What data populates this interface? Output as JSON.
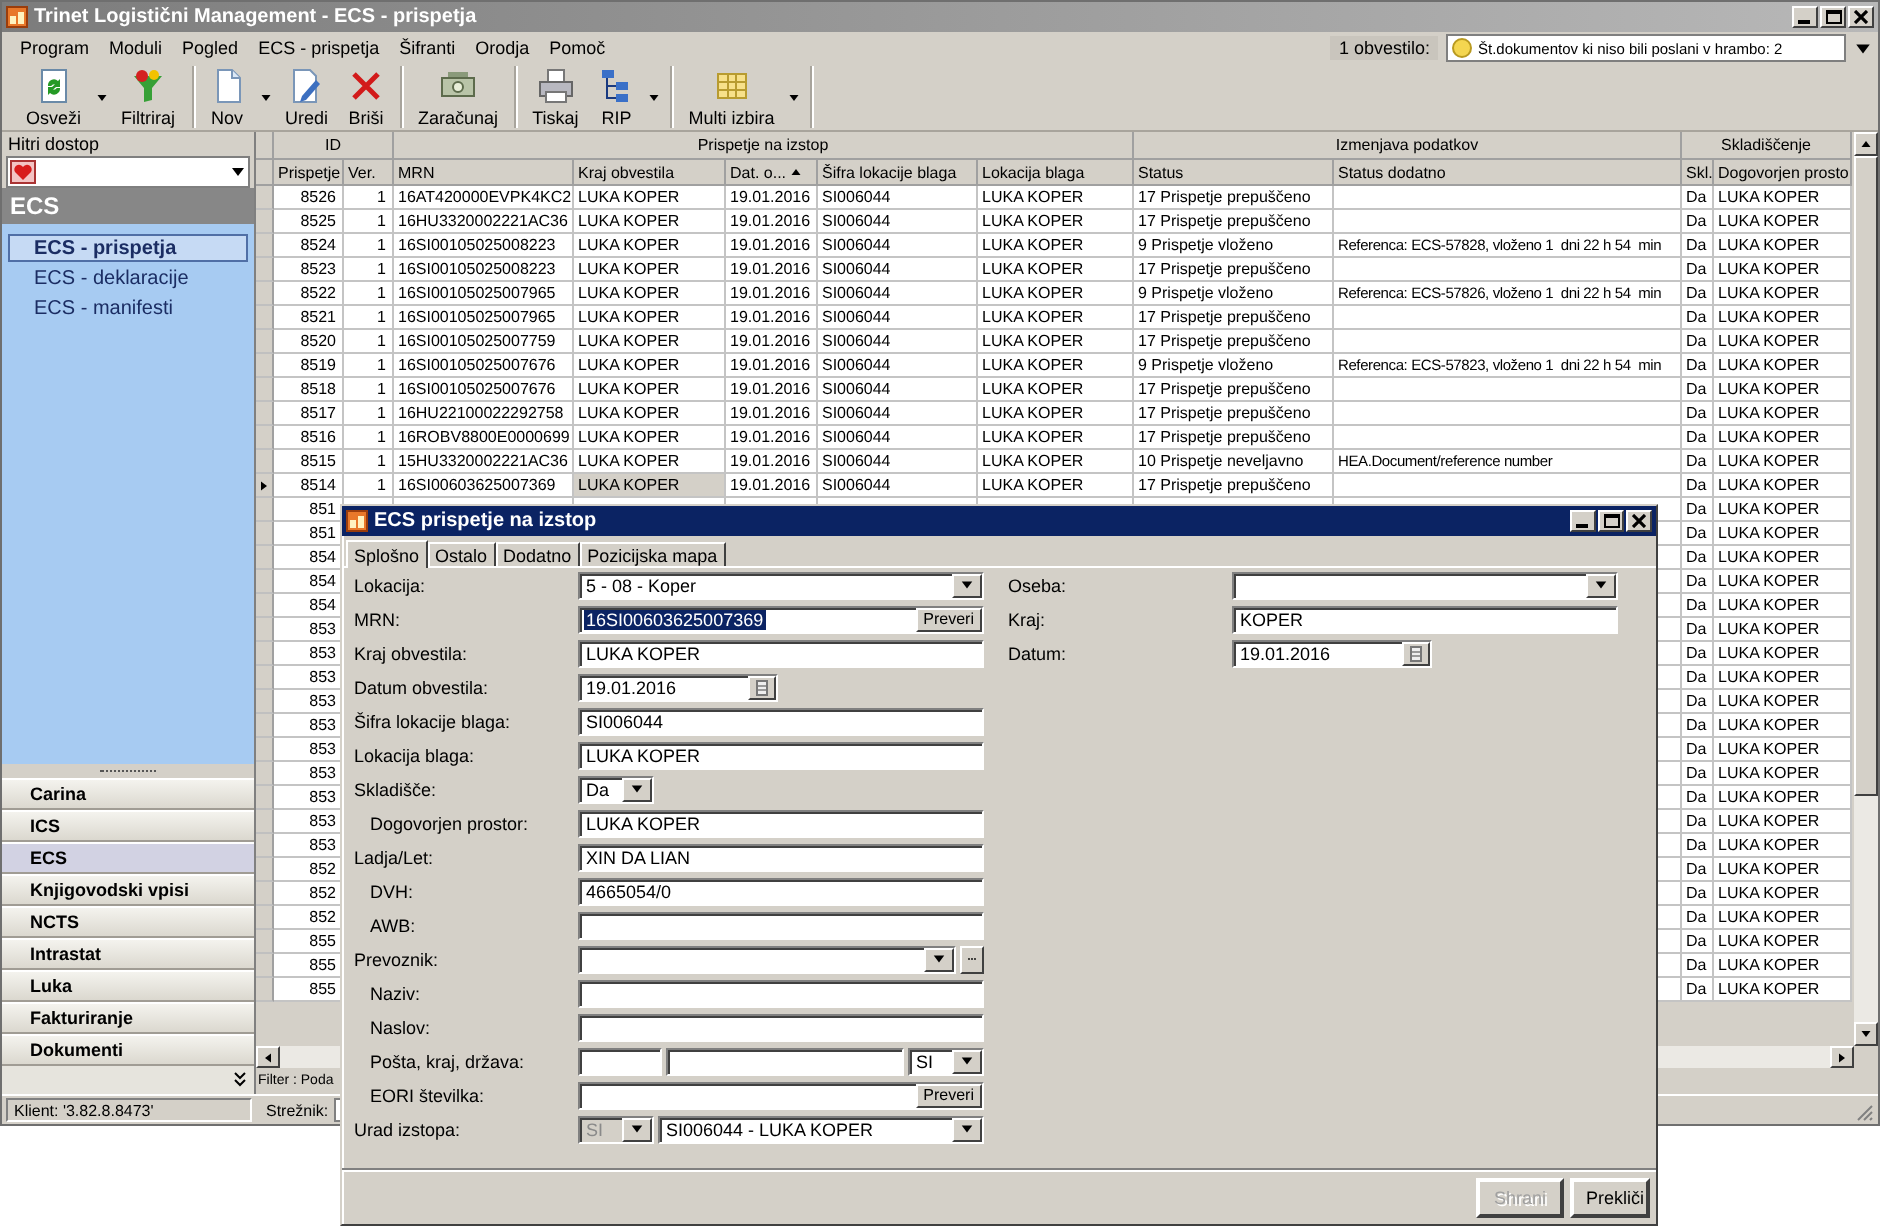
{
  "window": {
    "title": "Trinet Logistični Management - ECS - prispetja"
  },
  "menu": [
    "Program",
    "Moduli",
    "Pogled",
    "ECS - prispetja",
    "Šifranti",
    "Orodja",
    "Pomoč"
  ],
  "notification": {
    "label": "1 obvestilo:",
    "value": "Št.dokumentov ki niso bili poslani v hrambo: 2"
  },
  "toolbar": [
    {
      "items": [
        {
          "label": "Osveži",
          "kind": "refresh",
          "dropdown": true
        },
        {
          "label": "Filtriraj",
          "kind": "filter",
          "dropdown": false
        }
      ]
    },
    {
      "items": [
        {
          "label": "Nov",
          "kind": "new",
          "dropdown": true
        },
        {
          "label": "Uredi",
          "kind": "edit",
          "dropdown": false
        },
        {
          "label": "Briši",
          "kind": "delete",
          "dropdown": false
        }
      ]
    },
    {
      "items": [
        {
          "label": "Zaračunaj",
          "kind": "invoice",
          "dropdown": false
        }
      ]
    },
    {
      "items": [
        {
          "label": "Tiskaj",
          "kind": "print",
          "dropdown": false
        },
        {
          "label": "RIP",
          "kind": "tree",
          "dropdown": true
        }
      ]
    },
    {
      "items": [
        {
          "label": "Multi izbira",
          "kind": "multi",
          "dropdown": true
        }
      ]
    }
  ],
  "quick_access": {
    "title": "Hitri dostop",
    "module": "ECS",
    "items": [
      {
        "label": "ECS - prispetja",
        "selected": true
      },
      {
        "label": "ECS - deklaracije",
        "selected": false
      },
      {
        "label": "ECS - manifesti",
        "selected": false
      }
    ],
    "modules": [
      {
        "label": "Carina",
        "selected": false
      },
      {
        "label": "ICS",
        "selected": false
      },
      {
        "label": "ECS",
        "selected": true
      },
      {
        "label": "Knjigovodski vpisi",
        "selected": false
      },
      {
        "label": "NCTS",
        "selected": false
      },
      {
        "label": "Intrastat",
        "selected": false
      },
      {
        "label": "Luka",
        "selected": false
      },
      {
        "label": "Fakturiranje",
        "selected": false
      },
      {
        "label": "Dokumenti",
        "selected": false
      }
    ]
  },
  "grid": {
    "groups": [
      {
        "label": "ID",
        "columns": [
          {
            "label": "Prispetje"
          },
          {
            "label": "Ver."
          }
        ]
      },
      {
        "label": "Prispetje na izstop",
        "columns": [
          {
            "label": "MRN"
          },
          {
            "label": "Kraj obvestila"
          },
          {
            "label": "Dat. o...",
            "sorted": true
          },
          {
            "label": "Šifra lokacije blaga"
          },
          {
            "label": "Lokacija blaga"
          }
        ]
      },
      {
        "label": "Izmenjava podatkov",
        "columns": [
          {
            "label": "Status"
          },
          {
            "label": "Status dodatno"
          }
        ]
      },
      {
        "label": "Skladiščenje",
        "columns": [
          {
            "label": "Skl."
          },
          {
            "label": "Dogovorjen prosto"
          }
        ]
      }
    ],
    "rows": [
      {
        "selected": false,
        "id": "8526",
        "ver": "1",
        "mrn": "16AT420000EVPK4KC2",
        "place": "LUKA KOPER",
        "date": "19.01.2016",
        "location_code": "SI006044",
        "location": "LUKA KOPER",
        "status": "17 Prispetje prepuščeno",
        "storage": "Da",
        "storage_space": "LUKA KOPER"
      },
      {
        "selected": false,
        "id": "8525",
        "ver": "1",
        "mrn": "16HU3320002221AC36",
        "place": "LUKA KOPER",
        "date": "19.01.2016",
        "location_code": "SI006044",
        "location": "LUKA KOPER",
        "status": "17 Prispetje prepuščeno",
        "storage": "Da",
        "storage_space": "LUKA KOPER"
      },
      {
        "selected": false,
        "id": "8524",
        "ver": "1",
        "mrn": "16SI00105025008223",
        "place": "LUKA KOPER",
        "date": "19.01.2016",
        "location_code": "SI006044",
        "location": "LUKA KOPER",
        "status": "9 Prispetje vloženo",
        "status_detail": "Referenca: ECS-57828, vloženo 1  dni 22 h 54  min",
        "storage": "Da",
        "storage_space": "LUKA KOPER"
      },
      {
        "selected": false,
        "id": "8523",
        "ver": "1",
        "mrn": "16SI00105025008223",
        "place": "LUKA KOPER",
        "date": "19.01.2016",
        "location_code": "SI006044",
        "location": "LUKA KOPER",
        "status": "17 Prispetje prepuščeno",
        "storage": "Da",
        "storage_space": "LUKA KOPER"
      },
      {
        "selected": false,
        "id": "8522",
        "ver": "1",
        "mrn": "16SI00105025007965",
        "place": "LUKA KOPER",
        "date": "19.01.2016",
        "location_code": "SI006044",
        "location": "LUKA KOPER",
        "status": "9 Prispetje vloženo",
        "status_detail": "Referenca: ECS-57826, vloženo 1  dni 22 h 54  min",
        "storage": "Da",
        "storage_space": "LUKA KOPER"
      },
      {
        "selected": false,
        "id": "8521",
        "ver": "1",
        "mrn": "16SI00105025007965",
        "place": "LUKA KOPER",
        "date": "19.01.2016",
        "location_code": "SI006044",
        "location": "LUKA KOPER",
        "status": "17 Prispetje prepuščeno",
        "storage": "Da",
        "storage_space": "LUKA KOPER"
      },
      {
        "selected": false,
        "id": "8520",
        "ver": "1",
        "mrn": "16SI00105025007759",
        "place": "LUKA KOPER",
        "date": "19.01.2016",
        "location_code": "SI006044",
        "location": "LUKA KOPER",
        "status": "17 Prispetje prepuščeno",
        "storage": "Da",
        "storage_space": "LUKA KOPER"
      },
      {
        "selected": false,
        "id": "8519",
        "ver": "1",
        "mrn": "16SI00105025007676",
        "place": "LUKA KOPER",
        "date": "19.01.2016",
        "location_code": "SI006044",
        "location": "LUKA KOPER",
        "status": "9 Prispetje vloženo",
        "status_detail": "Referenca: ECS-57823, vloženo 1  dni 22 h 54  min",
        "storage": "Da",
        "storage_space": "LUKA KOPER"
      },
      {
        "selected": false,
        "id": "8518",
        "ver": "1",
        "mrn": "16SI00105025007676",
        "place": "LUKA KOPER",
        "date": "19.01.2016",
        "location_code": "SI006044",
        "location": "LUKA KOPER",
        "status": "17 Prispetje prepuščeno",
        "storage": "Da",
        "storage_space": "LUKA KOPER"
      },
      {
        "selected": false,
        "id": "8517",
        "ver": "1",
        "mrn": "16HU22100022292758",
        "place": "LUKA KOPER",
        "date": "19.01.2016",
        "location_code": "SI006044",
        "location": "LUKA KOPER",
        "status": "17 Prispetje prepuščeno",
        "storage": "Da",
        "storage_space": "LUKA KOPER"
      },
      {
        "selected": false,
        "id": "8516",
        "ver": "1",
        "mrn": "16ROBV8800E0000699",
        "place": "LUKA KOPER",
        "date": "19.01.2016",
        "location_code": "SI006044",
        "location": "LUKA KOPER",
        "status": "17 Prispetje prepuščeno",
        "storage": "Da",
        "storage_space": "LUKA KOPER"
      },
      {
        "selected": false,
        "id": "8515",
        "ver": "1",
        "mrn": "15HU3320002221AC36",
        "place": "LUKA KOPER",
        "date": "19.01.2016",
        "location_code": "SI006044",
        "location": "LUKA KOPER",
        "status": "10 Prispetje neveljavno",
        "status_detail": "HEA.Document/reference number",
        "storage": "Da",
        "storage_space": "LUKA KOPER"
      },
      {
        "selected": true,
        "id": "8514",
        "ver": "1",
        "mrn": "16SI00603625007369",
        "place": "LUKA KOPER",
        "date": "19.01.2016",
        "location_code": "SI006044",
        "location": "LUKA KOPER",
        "status": "17 Prispetje prepuščeno",
        "storage": "Da",
        "storage_space": "LUKA KOPER"
      },
      {
        "selected": false,
        "id": "851",
        "storage": "Da",
        "storage_space": "LUKA KOPER"
      },
      {
        "selected": false,
        "id": "851",
        "storage": "Da",
        "storage_space": "LUKA KOPER"
      },
      {
        "selected": false,
        "id": "854",
        "storage": "Da",
        "storage_space": "LUKA KOPER"
      },
      {
        "selected": false,
        "id": "854",
        "storage": "Da",
        "storage_space": "LUKA KOPER"
      },
      {
        "selected": false,
        "id": "854",
        "storage": "Da",
        "storage_space": "LUKA KOPER"
      },
      {
        "selected": false,
        "id": "853",
        "storage": "Da",
        "storage_space": "LUKA KOPER"
      },
      {
        "selected": false,
        "id": "853",
        "storage": "Da",
        "storage_space": "LUKA KOPER"
      },
      {
        "selected": false,
        "id": "853",
        "storage": "Da",
        "storage_space": "LUKA KOPER"
      },
      {
        "selected": false,
        "id": "853",
        "storage": "Da",
        "storage_space": "LUKA KOPER"
      },
      {
        "selected": false,
        "id": "853",
        "storage": "Da",
        "storage_space": "LUKA KOPER"
      },
      {
        "selected": false,
        "id": "853",
        "storage": "Da",
        "storage_space": "LUKA KOPER"
      },
      {
        "selected": false,
        "id": "853",
        "storage": "Da",
        "storage_space": "LUKA KOPER"
      },
      {
        "selected": false,
        "id": "853",
        "storage": "Da",
        "storage_space": "LUKA KOPER"
      },
      {
        "selected": false,
        "id": "853",
        "storage": "Da",
        "storage_space": "LUKA KOPER"
      },
      {
        "selected": false,
        "id": "853",
        "storage": "Da",
        "storage_space": "LUKA KOPER"
      },
      {
        "selected": false,
        "id": "852",
        "storage": "Da",
        "storage_space": "LUKA KOPER"
      },
      {
        "selected": false,
        "id": "852",
        "storage": "Da",
        "storage_space": "LUKA KOPER"
      },
      {
        "selected": false,
        "id": "852",
        "storage": "Da",
        "storage_space": "LUKA KOPER"
      },
      {
        "selected": false,
        "id": "855",
        "storage": "Da",
        "storage_space": "LUKA KOPER"
      },
      {
        "selected": false,
        "id": "855",
        "storage": "Da",
        "storage_space": "LUKA KOPER"
      },
      {
        "selected": false,
        "id": "855",
        "storage": "Da",
        "storage_space": "LUKA KOPER"
      }
    ]
  },
  "filter": "Filter : Poda",
  "status_bar": {
    "client": "Klient: '3.82.8.8473'",
    "server_label": "Strežnik:"
  },
  "dialog": {
    "title": "ECS prispetje na izstop",
    "tabs": [
      {
        "label": "Splošno",
        "selected": true
      },
      {
        "label": "Ostalo",
        "selected": false
      },
      {
        "label": "Dodatno",
        "selected": false
      },
      {
        "label": "Pozicijska mapa",
        "selected": false
      }
    ],
    "left_fields": [
      {
        "label": "Lokacija:",
        "controls": [
          {
            "kind": "dropdown",
            "value": "5 - 08 - Koper"
          }
        ]
      },
      {
        "label": "MRN:",
        "controls": [
          {
            "kind": "verify_text",
            "value": "16SI00603625007369",
            "highlighted": true,
            "button": "Preveri"
          }
        ]
      },
      {
        "label": "Kraj obvestila:",
        "controls": [
          {
            "kind": "text",
            "value": "LUKA KOPER"
          }
        ]
      },
      {
        "label": "Datum obvestila:",
        "controls": [
          {
            "kind": "date",
            "value": "19.01.2016"
          }
        ]
      },
      {
        "label": "Šifra lokacije blaga:",
        "controls": [
          {
            "kind": "text",
            "value": "SI006044"
          }
        ]
      },
      {
        "label": "Lokacija blaga:",
        "controls": [
          {
            "kind": "text",
            "value": "LUKA KOPER"
          }
        ]
      },
      {
        "label": "Skladišče:",
        "controls": [
          {
            "kind": "short_dropdown",
            "value": "Da"
          }
        ],
        "children": [
          {
            "label": "Dogovorjen prostor:",
            "controls": [
              {
                "kind": "text",
                "value": "LUKA KOPER"
              }
            ]
          }
        ]
      },
      {
        "label": "Ladja/Let:",
        "controls": [
          {
            "kind": "text",
            "value": "XIN DA LIAN"
          }
        ],
        "children": [
          {
            "label": "DVH:",
            "controls": [
              {
                "kind": "text",
                "value": "4665054/0"
              }
            ]
          },
          {
            "label": "AWB:",
            "controls": [
              {
                "kind": "text"
              }
            ]
          }
        ]
      },
      {
        "label": "Prevoznik:",
        "controls": [
          {
            "kind": "lookup"
          }
        ],
        "children": [
          {
            "label": "Naziv:",
            "controls": [
              {
                "kind": "text"
              }
            ]
          },
          {
            "label": "Naslov:",
            "controls": [
              {
                "kind": "text"
              }
            ]
          },
          {
            "label": "Pošta, kraj, država:",
            "controls": [
              {
                "kind": "short_text"
              },
              {
                "kind": "text"
              },
              {
                "kind": "short_dropdown",
                "value": "SI"
              }
            ]
          },
          {
            "label": "EORI številka:",
            "controls": [
              {
                "kind": "verify_text",
                "button": "Preveri"
              }
            ]
          }
        ]
      },
      {
        "label": "Urad izstopa:",
        "controls": [
          {
            "kind": "short_dropdown",
            "value": "SI",
            "disabled": true
          },
          {
            "kind": "dropdown",
            "value": "SI006044 - LUKA KOPER",
            "disabled": false
          }
        ]
      }
    ],
    "right_fields": [
      {
        "label": "Oseba:",
        "controls": [
          {
            "kind": "dropdown"
          }
        ]
      },
      {
        "label": "Kraj:",
        "controls": [
          {
            "kind": "text",
            "value": "KOPER"
          }
        ]
      },
      {
        "label": "Datum:",
        "controls": [
          {
            "kind": "date",
            "value": "19.01.2016"
          }
        ]
      }
    ],
    "buttons": [
      {
        "label": "Shrani",
        "disabled": true
      },
      {
        "label": "Prekliči",
        "disabled": false
      }
    ]
  }
}
